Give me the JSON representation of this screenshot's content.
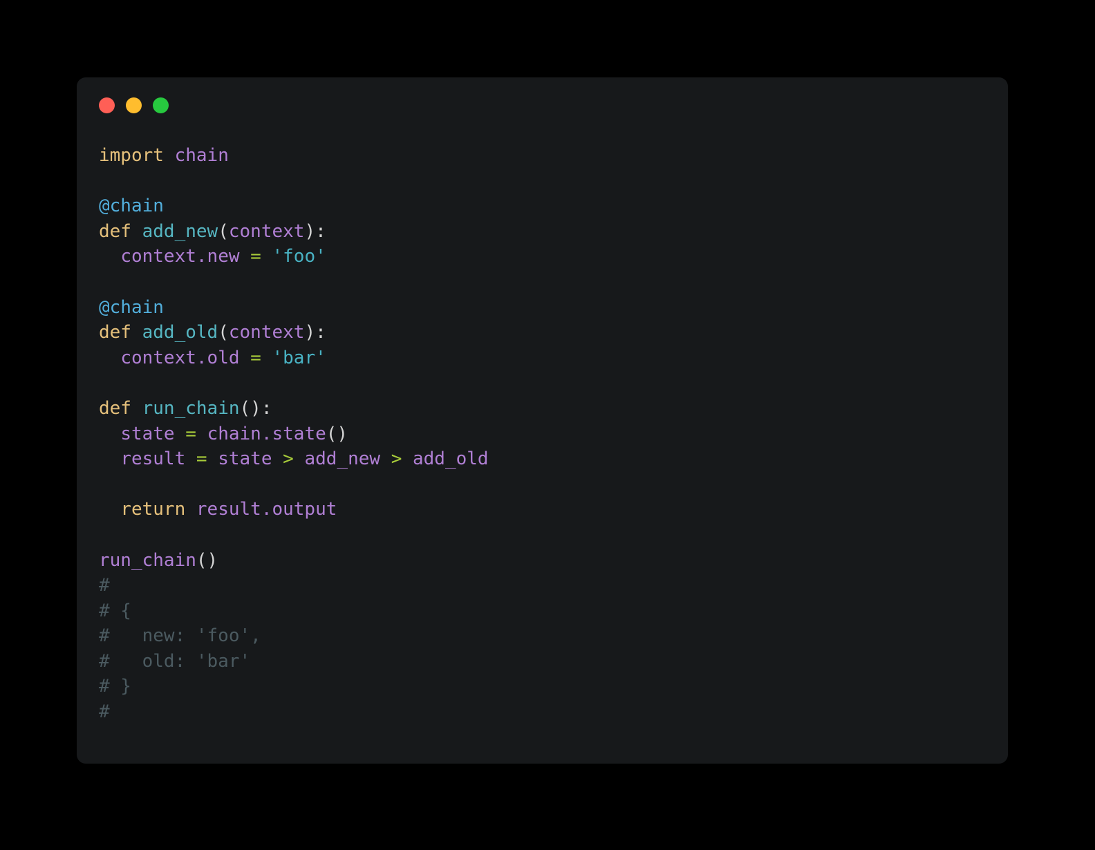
{
  "window": {
    "background": "#17191b",
    "page_background": "#000000",
    "traffic_lights": [
      {
        "name": "close-button",
        "color": "#ff5f56"
      },
      {
        "name": "minimize-button",
        "color": "#ffbd2e"
      },
      {
        "name": "maximize-button",
        "color": "#27c93f"
      }
    ]
  },
  "theme": {
    "keyword": "#e5c07b",
    "decorator": "#52aedb",
    "function": "#56b6c2",
    "variable": "#b07fd4",
    "string": "#49b3c4",
    "operator": "#a8cc3a",
    "punctuation": "#d4d4d4",
    "comment": "#4b5a60"
  },
  "code": {
    "language": "python",
    "plain_text": "import chain\n\n@chain\ndef add_new(context):\n  context.new = 'foo'\n\n@chain\ndef add_old(context):\n  context.old = 'bar'\n\ndef run_chain():\n  state = chain.state()\n  result = state > add_new > add_old\n\n  return result.output\n\nrun_chain()\n#\n# {\n#   new: 'foo',\n#   old: 'bar'\n# }\n#",
    "lines": [
      {
        "tokens": [
          {
            "t": "import",
            "c": "t-kw"
          },
          {
            "t": " ",
            "c": "t-punc"
          },
          {
            "t": "chain",
            "c": "t-var"
          }
        ]
      },
      {
        "tokens": []
      },
      {
        "tokens": [
          {
            "t": "@chain",
            "c": "t-dec"
          }
        ]
      },
      {
        "tokens": [
          {
            "t": "def",
            "c": "t-kw"
          },
          {
            "t": " ",
            "c": "t-punc"
          },
          {
            "t": "add_new",
            "c": "t-fn"
          },
          {
            "t": "(",
            "c": "t-punc"
          },
          {
            "t": "context",
            "c": "t-var"
          },
          {
            "t": "):",
            "c": "t-punc"
          }
        ]
      },
      {
        "tokens": [
          {
            "t": "  ",
            "c": "t-punc"
          },
          {
            "t": "context",
            "c": "t-var"
          },
          {
            "t": ".",
            "c": "t-var"
          },
          {
            "t": "new",
            "c": "t-var"
          },
          {
            "t": " ",
            "c": "t-punc"
          },
          {
            "t": "=",
            "c": "t-op"
          },
          {
            "t": " ",
            "c": "t-punc"
          },
          {
            "t": "'foo'",
            "c": "t-str"
          }
        ]
      },
      {
        "tokens": []
      },
      {
        "tokens": [
          {
            "t": "@chain",
            "c": "t-dec"
          }
        ]
      },
      {
        "tokens": [
          {
            "t": "def",
            "c": "t-kw"
          },
          {
            "t": " ",
            "c": "t-punc"
          },
          {
            "t": "add_old",
            "c": "t-fn"
          },
          {
            "t": "(",
            "c": "t-punc"
          },
          {
            "t": "context",
            "c": "t-var"
          },
          {
            "t": "):",
            "c": "t-punc"
          }
        ]
      },
      {
        "tokens": [
          {
            "t": "  ",
            "c": "t-punc"
          },
          {
            "t": "context",
            "c": "t-var"
          },
          {
            "t": ".",
            "c": "t-var"
          },
          {
            "t": "old",
            "c": "t-var"
          },
          {
            "t": " ",
            "c": "t-punc"
          },
          {
            "t": "=",
            "c": "t-op"
          },
          {
            "t": " ",
            "c": "t-punc"
          },
          {
            "t": "'bar'",
            "c": "t-str"
          }
        ]
      },
      {
        "tokens": []
      },
      {
        "tokens": [
          {
            "t": "def",
            "c": "t-kw"
          },
          {
            "t": " ",
            "c": "t-punc"
          },
          {
            "t": "run_chain",
            "c": "t-fn"
          },
          {
            "t": "():",
            "c": "t-punc"
          }
        ]
      },
      {
        "tokens": [
          {
            "t": "  ",
            "c": "t-punc"
          },
          {
            "t": "state",
            "c": "t-var"
          },
          {
            "t": " ",
            "c": "t-punc"
          },
          {
            "t": "=",
            "c": "t-op"
          },
          {
            "t": " ",
            "c": "t-punc"
          },
          {
            "t": "chain",
            "c": "t-var"
          },
          {
            "t": ".",
            "c": "t-var"
          },
          {
            "t": "state",
            "c": "t-var"
          },
          {
            "t": "()",
            "c": "t-punc"
          }
        ]
      },
      {
        "tokens": [
          {
            "t": "  ",
            "c": "t-punc"
          },
          {
            "t": "result",
            "c": "t-var"
          },
          {
            "t": " ",
            "c": "t-punc"
          },
          {
            "t": "=",
            "c": "t-op"
          },
          {
            "t": " ",
            "c": "t-punc"
          },
          {
            "t": "state",
            "c": "t-var"
          },
          {
            "t": " ",
            "c": "t-punc"
          },
          {
            "t": ">",
            "c": "t-op"
          },
          {
            "t": " ",
            "c": "t-punc"
          },
          {
            "t": "add_new",
            "c": "t-var"
          },
          {
            "t": " ",
            "c": "t-punc"
          },
          {
            "t": ">",
            "c": "t-op"
          },
          {
            "t": " ",
            "c": "t-punc"
          },
          {
            "t": "add_old",
            "c": "t-var"
          }
        ]
      },
      {
        "tokens": []
      },
      {
        "tokens": [
          {
            "t": "  ",
            "c": "t-punc"
          },
          {
            "t": "return",
            "c": "t-kw"
          },
          {
            "t": " ",
            "c": "t-punc"
          },
          {
            "t": "result",
            "c": "t-var"
          },
          {
            "t": ".",
            "c": "t-var"
          },
          {
            "t": "output",
            "c": "t-var"
          }
        ]
      },
      {
        "tokens": []
      },
      {
        "tokens": [
          {
            "t": "run_chain",
            "c": "t-var"
          },
          {
            "t": "()",
            "c": "t-punc"
          }
        ]
      },
      {
        "tokens": [
          {
            "t": "#",
            "c": "t-comment"
          }
        ]
      },
      {
        "tokens": [
          {
            "t": "# {",
            "c": "t-comment"
          }
        ]
      },
      {
        "tokens": [
          {
            "t": "#   new: 'foo',",
            "c": "t-comment"
          }
        ]
      },
      {
        "tokens": [
          {
            "t": "#   old: 'bar'",
            "c": "t-comment"
          }
        ]
      },
      {
        "tokens": [
          {
            "t": "# }",
            "c": "t-comment"
          }
        ]
      },
      {
        "tokens": [
          {
            "t": "#",
            "c": "t-comment"
          }
        ]
      }
    ]
  }
}
